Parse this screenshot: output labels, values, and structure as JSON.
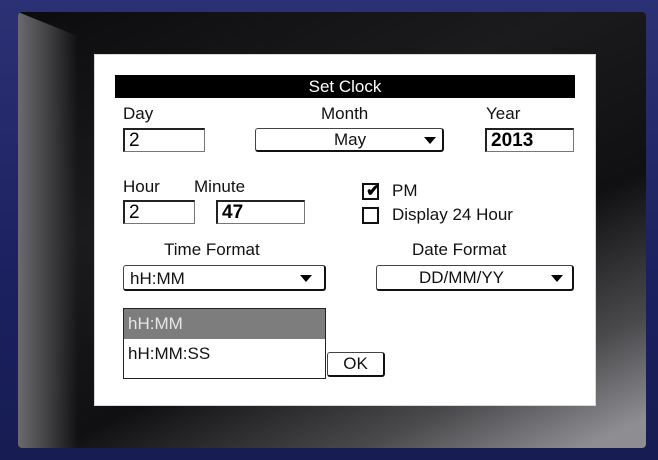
{
  "dialog": {
    "title": "Set Clock",
    "day": {
      "label": "Day",
      "value": "2"
    },
    "month": {
      "label": "Month",
      "value": "May"
    },
    "year": {
      "label": "Year",
      "value": "2013"
    },
    "hour": {
      "label": "Hour",
      "value": "2"
    },
    "minute": {
      "label": "Minute",
      "value": "47"
    },
    "pm": {
      "label": "PM",
      "checked": true
    },
    "display24": {
      "label": "Display 24 Hour",
      "checked": false
    },
    "time_format": {
      "label": "Time Format",
      "value": "hH:MM",
      "options": [
        "hH:MM",
        "hH:MM:SS"
      ],
      "selected_index": 0
    },
    "date_format": {
      "label": "Date Format",
      "value": "DD/MM/YY"
    },
    "ok_label": "OK"
  },
  "icons": {
    "dropdown": "chevron-down-icon",
    "check": "checkmark-icon"
  },
  "colors": {
    "title_bg": "#000000",
    "title_fg": "#ffffff",
    "selection_bg": "#7d7d7d",
    "device_bezel": "#1f2566"
  }
}
